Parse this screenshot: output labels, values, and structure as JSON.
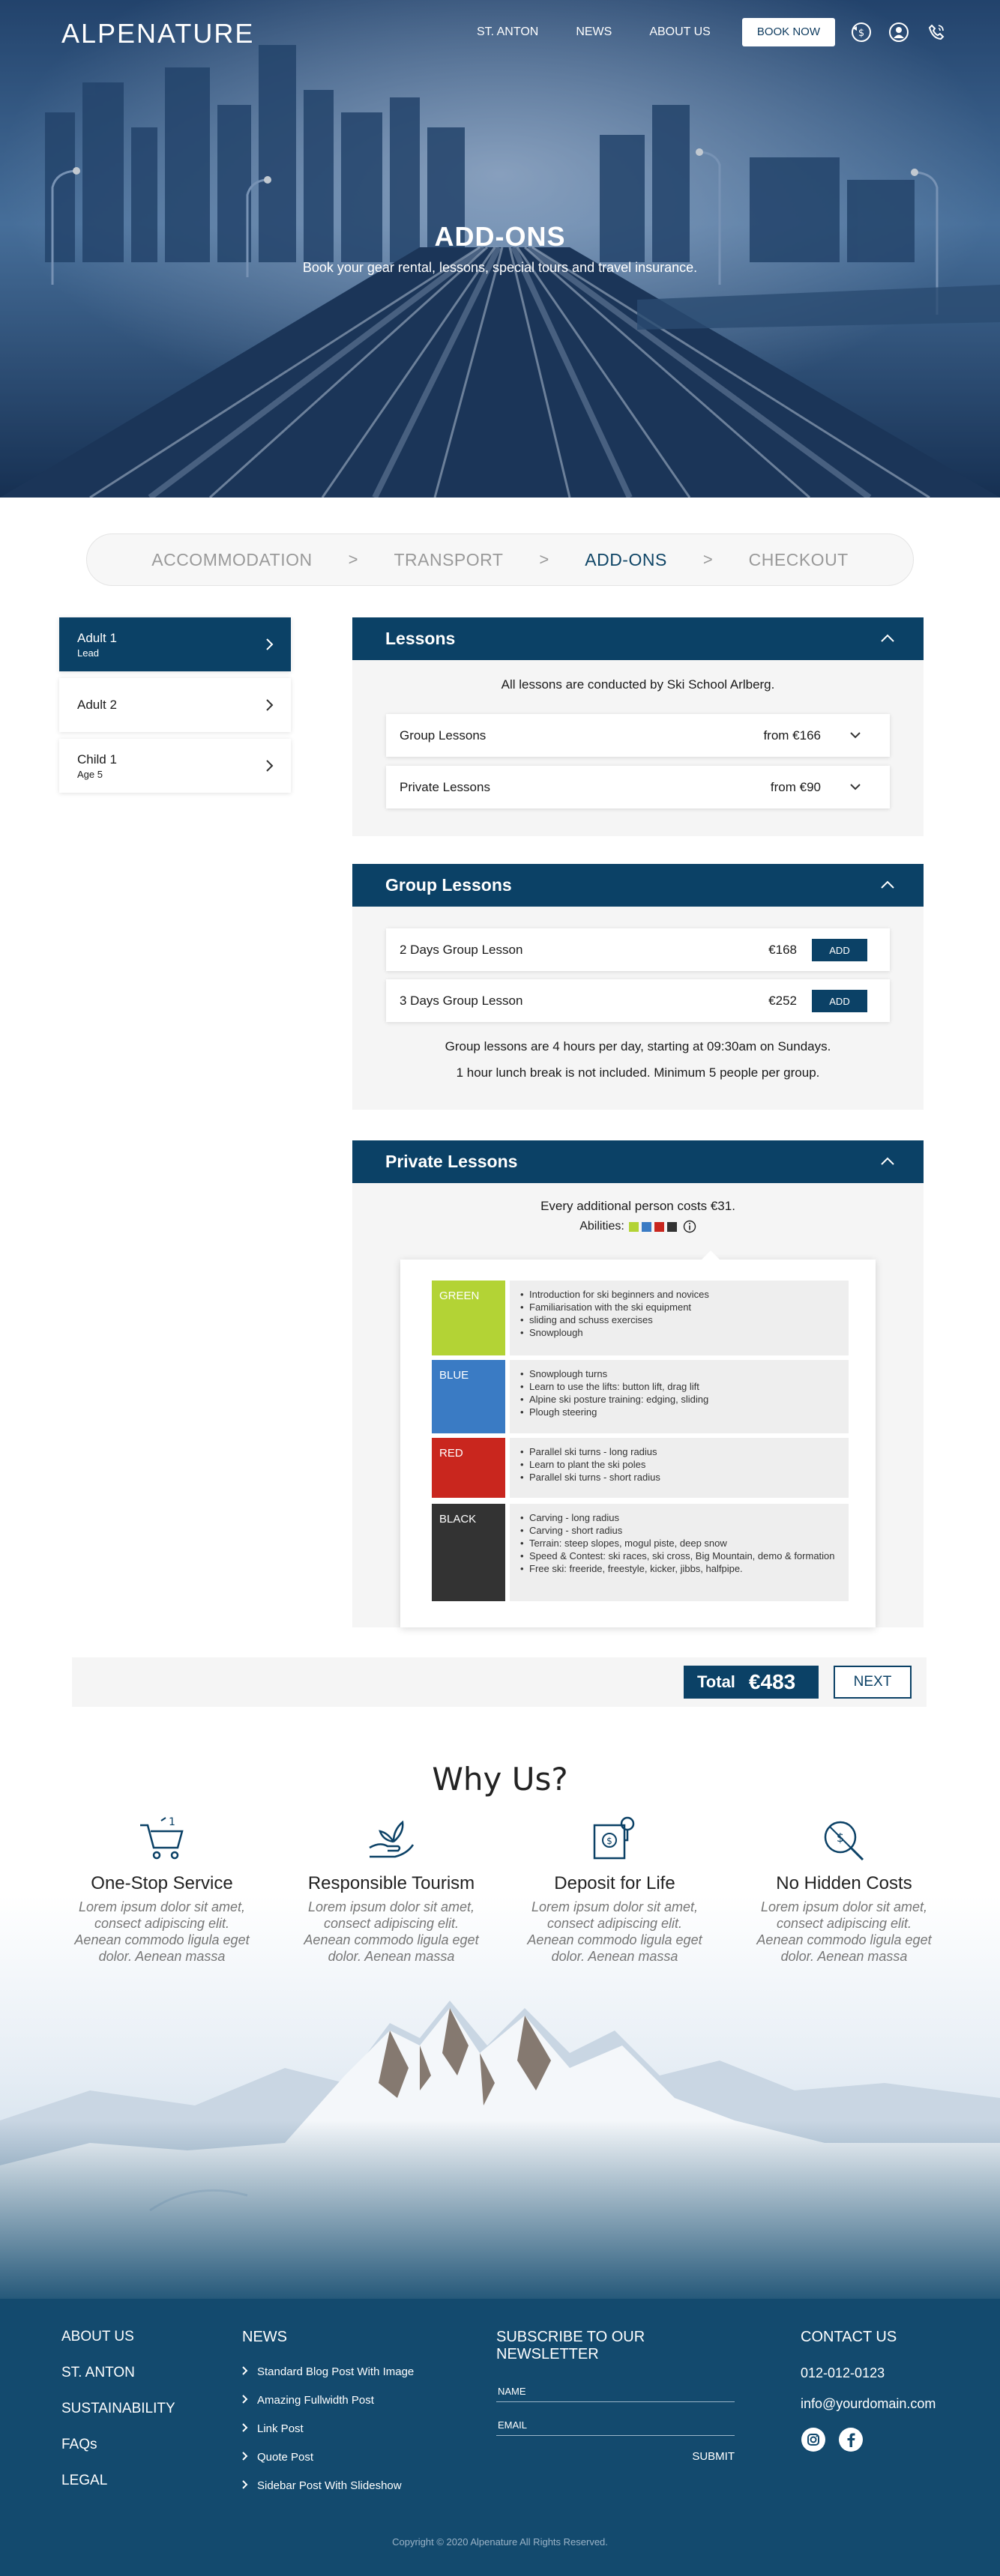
{
  "header": {
    "logo": "ALPENATURE",
    "nav": [
      "ST. ANTON",
      "NEWS",
      "ABOUT US"
    ],
    "book_now": "BOOK NOW",
    "icons": [
      "currency-exchange-icon",
      "user-icon",
      "phone-icon"
    ]
  },
  "hero": {
    "title": "ADD-ONS",
    "subtitle": "Book your gear rental, lessons, special tours and travel insurance."
  },
  "steps": {
    "items": [
      "ACCOMMODATION",
      "TRANSPORT",
      "ADD-ONS",
      "CHECKOUT"
    ],
    "separator": ">",
    "active": "ADD-ONS"
  },
  "persons": [
    {
      "name": "Adult 1",
      "sub": "Lead",
      "active": true
    },
    {
      "name": "Adult 2",
      "sub": "",
      "active": false
    },
    {
      "name": "Child 1",
      "sub": "Age 5",
      "active": false
    }
  ],
  "lessons": {
    "title": "Lessons",
    "intro": "All lessons are conducted by Ski School Arlberg.",
    "rows": [
      {
        "label": "Group Lessons",
        "price": "from €166"
      },
      {
        "label": "Private Lessons",
        "price": "from €90"
      }
    ]
  },
  "group": {
    "title": "Group Lessons",
    "rows": [
      {
        "label": "2 Days Group Lesson",
        "price": "€168",
        "button": "ADD"
      },
      {
        "label": "3 Days Group Lesson",
        "price": "€252",
        "button": "ADD"
      }
    ],
    "note1": "Group lessons are 4 hours per day, starting at 09:30am on Sundays.",
    "note2": "1 hour lunch break is not included. Minimum 5 people per group."
  },
  "private": {
    "title": "Private Lessons",
    "note": "Every additional person costs €31.",
    "abilities_label": "Abilities:",
    "ability_colors": [
      "#b3d335",
      "#3a7bc4",
      "#c9261e",
      "#333333"
    ],
    "abilities": [
      {
        "name": "GREEN",
        "color": "#b3d335",
        "items": [
          "Introduction for ski beginners and novices",
          "Familiarisation with the ski equipment",
          "sliding and schuss exercises",
          "Snowplough"
        ]
      },
      {
        "name": "BLUE",
        "color": "#3a7bc4",
        "items": [
          "Snowplough turns",
          "Learn to use the lifts: button lift, drag lift",
          "Alpine ski posture training: edging, sliding",
          "Plough steering"
        ]
      },
      {
        "name": "RED",
        "color": "#c9261e",
        "items": [
          "Parallel ski turns - long radius",
          "Learn to plant the ski poles",
          "Parallel ski turns - short radius"
        ]
      },
      {
        "name": "BLACK",
        "color": "#333333",
        "items": [
          "Carving - long radius",
          "Carving - short radius",
          "Terrain: steep slopes, mogul piste, deep snow",
          "Speed & Contest: ski races, ski cross, Big Mountain, demo & formation",
          "Free ski: freeride, freestyle, kicker, jibbs, halfpipe."
        ]
      }
    ]
  },
  "totals": {
    "label": "Total",
    "value": "€483",
    "next": "NEXT"
  },
  "why": {
    "title": "Why Us?",
    "features": [
      {
        "icon": "cart-icon",
        "title": "One-Stop Service",
        "text": "Lorem ipsum dolor sit amet, consect adipiscing elit. Aenean commodo ligula eget dolor. Aenean massa"
      },
      {
        "icon": "hand-plant-icon",
        "title": "Responsible Tourism",
        "text": "Lorem ipsum dolor sit amet, consect adipiscing elit. Aenean commodo ligula eget dolor. Aenean massa"
      },
      {
        "icon": "deposit-icon",
        "title": "Deposit for Life",
        "text": "Lorem ipsum dolor sit amet, consect adipiscing elit. Aenean commodo ligula eget dolor. Aenean massa"
      },
      {
        "icon": "no-fees-icon",
        "title": "No Hidden Costs",
        "text": "Lorem ipsum dolor sit amet, consect adipiscing elit. Aenean commodo ligula eget dolor. Aenean massa"
      }
    ]
  },
  "footer": {
    "links": [
      "ABOUT US",
      "ST. ANTON",
      "SUSTAINABILITY",
      "FAQs",
      "LEGAL"
    ],
    "news_title": "NEWS",
    "news": [
      "Standard Blog Post With Image",
      "Amazing Fullwidth Post",
      "Link Post",
      "Quote Post",
      "Sidebar Post With Slideshow"
    ],
    "newsletter_title": "SUBSCRIBE TO OUR NEWSLETTER",
    "name_label": "NAME",
    "email_label": "EMAIL",
    "submit": "SUBMIT",
    "contact_title": "CONTACT US",
    "phone": "012-012-0123",
    "email": "info@yourdomain.com",
    "social": [
      "instagram-icon",
      "facebook-icon"
    ],
    "copyright": "Copyright © 2020  Alpenature  All Rights Reserved."
  },
  "colors": {
    "primary": "#0b4166",
    "footer": "#134a6e",
    "panel_bg": "#f5f5f5"
  }
}
